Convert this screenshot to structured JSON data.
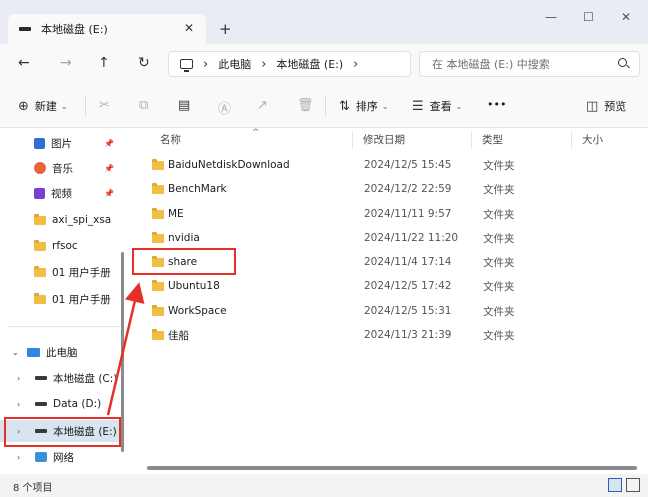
{
  "tab": {
    "title": "本地磁盘 (E:)",
    "close": "✕",
    "new_tab": "+"
  },
  "window_controls": {
    "minimize": "—",
    "maximize": "☐",
    "close": "✕"
  },
  "nav": {
    "back": "←",
    "forward": "→",
    "up": "↑",
    "refresh": "↻"
  },
  "address": {
    "crumbs": [
      "此电脑",
      "本地磁盘 (E:)"
    ],
    "sep": "›"
  },
  "search": {
    "placeholder": "在 本地磁盘 (E:) 中搜索"
  },
  "command_bar": {
    "new_label": "新建",
    "sort_label": "排序",
    "view_label": "查看",
    "more": "•••",
    "preview_label": "预览"
  },
  "sidebar": {
    "quick_access": [
      {
        "label": "图片",
        "icon": "pictures-icon",
        "pinned": true
      },
      {
        "label": "音乐",
        "icon": "music-icon",
        "pinned": true
      },
      {
        "label": "视频",
        "icon": "videos-icon",
        "pinned": true
      },
      {
        "label": "axi_spi_xsa",
        "icon": "folder-icon",
        "pinned": false
      },
      {
        "label": "rfsoc",
        "icon": "folder-icon",
        "pinned": false
      },
      {
        "label": "01 用户手册",
        "icon": "folder-icon",
        "pinned": false
      },
      {
        "label": "01 用户手册",
        "icon": "folder-icon",
        "pinned": false
      }
    ],
    "this_pc": "此电脑",
    "drives": [
      {
        "label": "本地磁盘 (C:)",
        "selected": false
      },
      {
        "label": "Data (D:)",
        "selected": false
      },
      {
        "label": "本地磁盘 (E:)",
        "selected": true
      }
    ],
    "network": "网络"
  },
  "columns": {
    "name": "名称",
    "date": "修改日期",
    "type": "类型",
    "size": "大小"
  },
  "files": [
    {
      "name": "BaiduNetdiskDownload",
      "date": "2024/12/5 15:45",
      "type": "文件夹"
    },
    {
      "name": "BenchMark",
      "date": "2024/12/2 22:59",
      "type": "文件夹"
    },
    {
      "name": "ME",
      "date": "2024/11/11 9:57",
      "type": "文件夹"
    },
    {
      "name": "nvidia",
      "date": "2024/11/22 11:20",
      "type": "文件夹"
    },
    {
      "name": "share",
      "date": "2024/11/4 17:14",
      "type": "文件夹"
    },
    {
      "name": "Ubuntu18",
      "date": "2024/12/5 17:42",
      "type": "文件夹"
    },
    {
      "name": "WorkSpace",
      "date": "2024/12/5 15:31",
      "type": "文件夹"
    },
    {
      "name": "佳船",
      "date": "2024/11/3 21:39",
      "type": "文件夹"
    }
  ],
  "status": {
    "item_count": "8 个项目"
  },
  "highlight_color": "#e53027"
}
